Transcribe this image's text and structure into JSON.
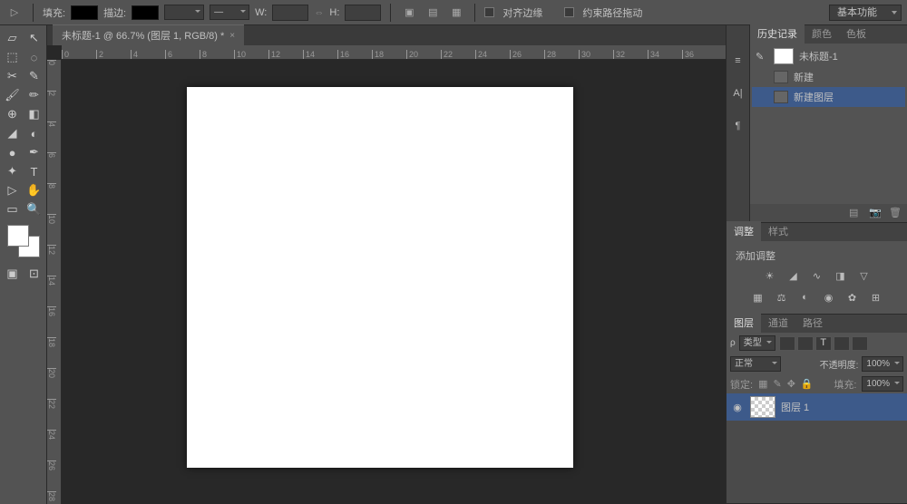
{
  "topbar": {
    "fill_label": "填充:",
    "stroke_label": "描边:",
    "w_label": "W:",
    "h_label": "H:",
    "align_edges": "对齐边缘",
    "constrain_path": "约束路径拖动",
    "workspace": "基本功能"
  },
  "doc": {
    "tab_title": "未标题-1 @ 66.7% (图层 1, RGB/8) *"
  },
  "ruler_h": [
    "0",
    "2",
    "4",
    "6",
    "8",
    "10",
    "12",
    "14",
    "16",
    "18",
    "20",
    "22",
    "24",
    "26",
    "28",
    "30",
    "32",
    "34",
    "36"
  ],
  "ruler_v": [
    "0",
    "2",
    "4",
    "6",
    "8",
    "10",
    "12",
    "14",
    "16",
    "18",
    "20",
    "22",
    "24",
    "26",
    "28"
  ],
  "history": {
    "tabs": [
      "历史记录",
      "颜色",
      "色板"
    ],
    "doc_name": "未标题-1",
    "items": [
      "新建",
      "新建图层"
    ]
  },
  "adjust": {
    "tabs": [
      "调整",
      "样式"
    ],
    "title": "添加调整"
  },
  "layers": {
    "tabs": [
      "图层",
      "通道",
      "路径"
    ],
    "kind_label": "类型",
    "blend": "正常",
    "opacity_label": "不透明度:",
    "opacity_val": "100%",
    "lock_label": "锁定:",
    "fill_label": "填充:",
    "fill_val": "100%",
    "layer_name": "图层 1"
  }
}
